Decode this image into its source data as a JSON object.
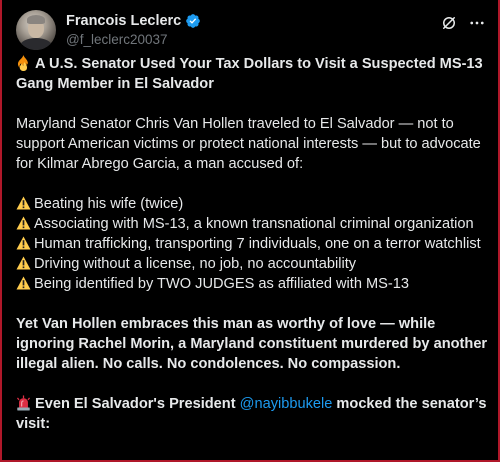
{
  "author": {
    "display_name": "Francois Leclerc",
    "handle": "@f_leclerc20037",
    "avatar_icon": "avatar",
    "verified_icon": "verified-badge-icon",
    "verified_color": "#1d9bf0"
  },
  "actions": {
    "grok_icon": "grok-icon",
    "more_icon": "more-icon"
  },
  "post": {
    "headline": "A U.S. Senator Used Your Tax Dollars to Visit a Suspected MS-13 Gang Member in El Salvador",
    "headline_icon": "fire-icon",
    "intro": "Maryland Senator Chris Van Hollen traveled to El Salvador — not to support American victims or protect national interests — but to advocate for Kilmar Abrego Garcia, a man accused of:",
    "accusations": [
      "Beating his wife (twice)",
      "Associating with MS-13, a known transnational criminal organization",
      "Human trafficking, transporting 7 individuals, one on a terror watchlist",
      "Driving without a license, no job, no accountability",
      "Being identified by TWO JUDGES as affiliated with MS-13"
    ],
    "accusation_icon": "warning-icon",
    "closing": "Yet Van Hollen embraces this man as worthy of love — while ignoring Rachel Morin, a Maryland constituent murdered by another illegal alien. No calls. No condolences. No compassion.",
    "final_prefix": "Even El Salvador's President",
    "final_mention": "@nayibbukele",
    "final_suffix": "mocked the senator’s visit:",
    "final_icon": "siren-icon",
    "mention_color": "#1d9bf0"
  }
}
